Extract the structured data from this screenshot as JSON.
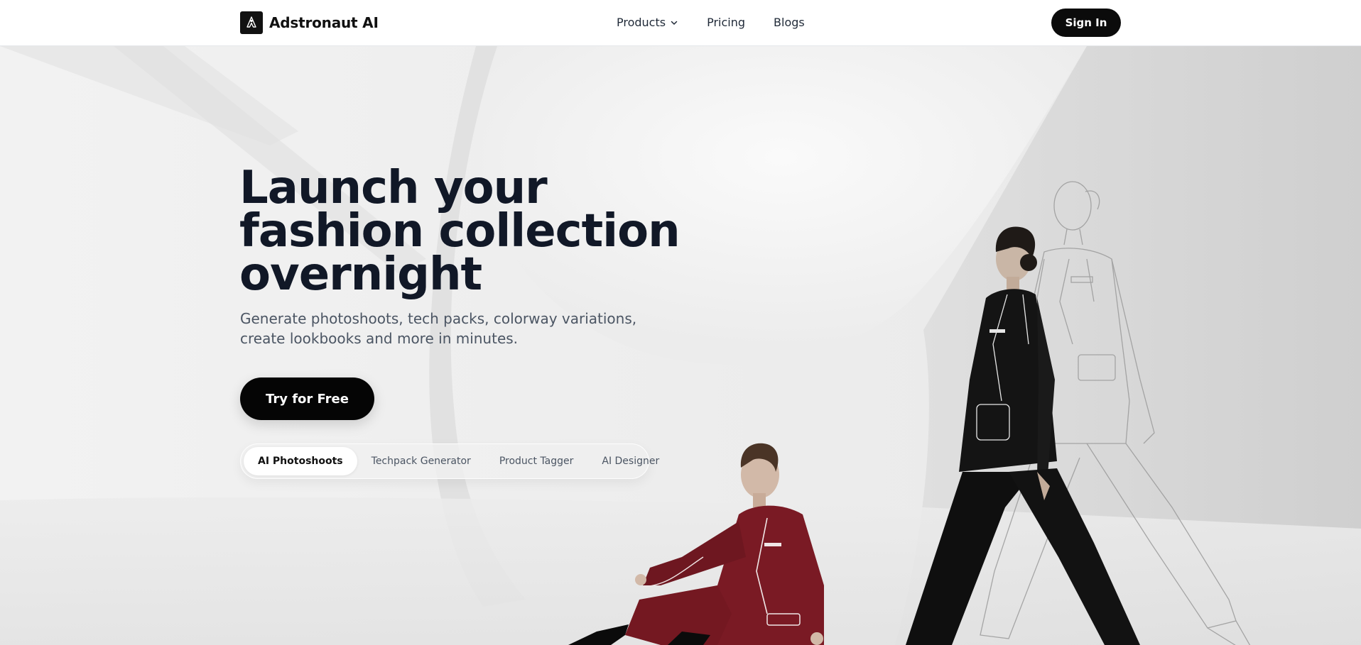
{
  "nav": {
    "brand_name": "Adstronaut AI",
    "links": [
      {
        "label": "Products",
        "has_dropdown": true
      },
      {
        "label": "Pricing"
      },
      {
        "label": "Blogs"
      }
    ],
    "signin_label": "Sign In"
  },
  "hero": {
    "headline_lines": [
      "Launch your",
      "fashion collection",
      "overnight"
    ],
    "subhead": "Generate photoshoots, tech packs, colorway variations, create lookbooks and more in minutes.",
    "cta_label": "Try for Free",
    "tabs": [
      {
        "label": "AI Photoshoots",
        "active": true
      },
      {
        "label": "Techpack Generator",
        "active": false
      },
      {
        "label": "Product Tagger",
        "active": false
      },
      {
        "label": "AI Designer",
        "active": false
      }
    ]
  },
  "colors": {
    "ink": "#111827",
    "button": "#050505",
    "suit_red": "#7a1a24",
    "suit_black": "#141414"
  }
}
